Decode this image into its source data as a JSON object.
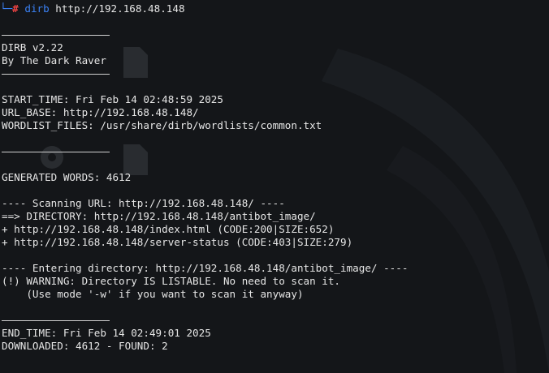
{
  "prompt": {
    "corner": "└─",
    "symbol": "#",
    "command": "dirb",
    "args": "http://192.168.48.148"
  },
  "banner": {
    "version": "DIRB v2.22",
    "author": "By The Dark Raver"
  },
  "info": {
    "start_time": "START_TIME: Fri Feb 14 02:48:59 2025",
    "url_base": "URL_BASE: http://192.168.48.148/",
    "wordlist": "WORDLIST_FILES: /usr/share/dirb/wordlists/common.txt"
  },
  "generated": "GENERATED WORDS: 4612",
  "scan": {
    "scanning": "---- Scanning URL: http://192.168.48.148/ ----",
    "directory": "==> DIRECTORY: http://192.168.48.148/antibot_image/",
    "result1": "+ http://192.168.48.148/index.html (CODE:200|SIZE:652)",
    "result2": "+ http://192.168.48.148/server-status (CODE:403|SIZE:279)"
  },
  "entering": {
    "header": "---- Entering directory: http://192.168.48.148/antibot_image/ ----",
    "warning": "(!) WARNING: Directory IS LISTABLE. No need to scan it.",
    "hint": "    (Use mode '-w' if you want to scan it anyway)"
  },
  "end": {
    "end_time": "END_TIME: Fri Feb 14 02:49:01 2025",
    "downloaded": "DOWNLOADED: 4612 - FOUND: 2"
  },
  "colors": {
    "background": "#141619",
    "text": "#e6e6e6",
    "prompt_blue": "#3b82f6",
    "prompt_red": "#ef4444"
  }
}
